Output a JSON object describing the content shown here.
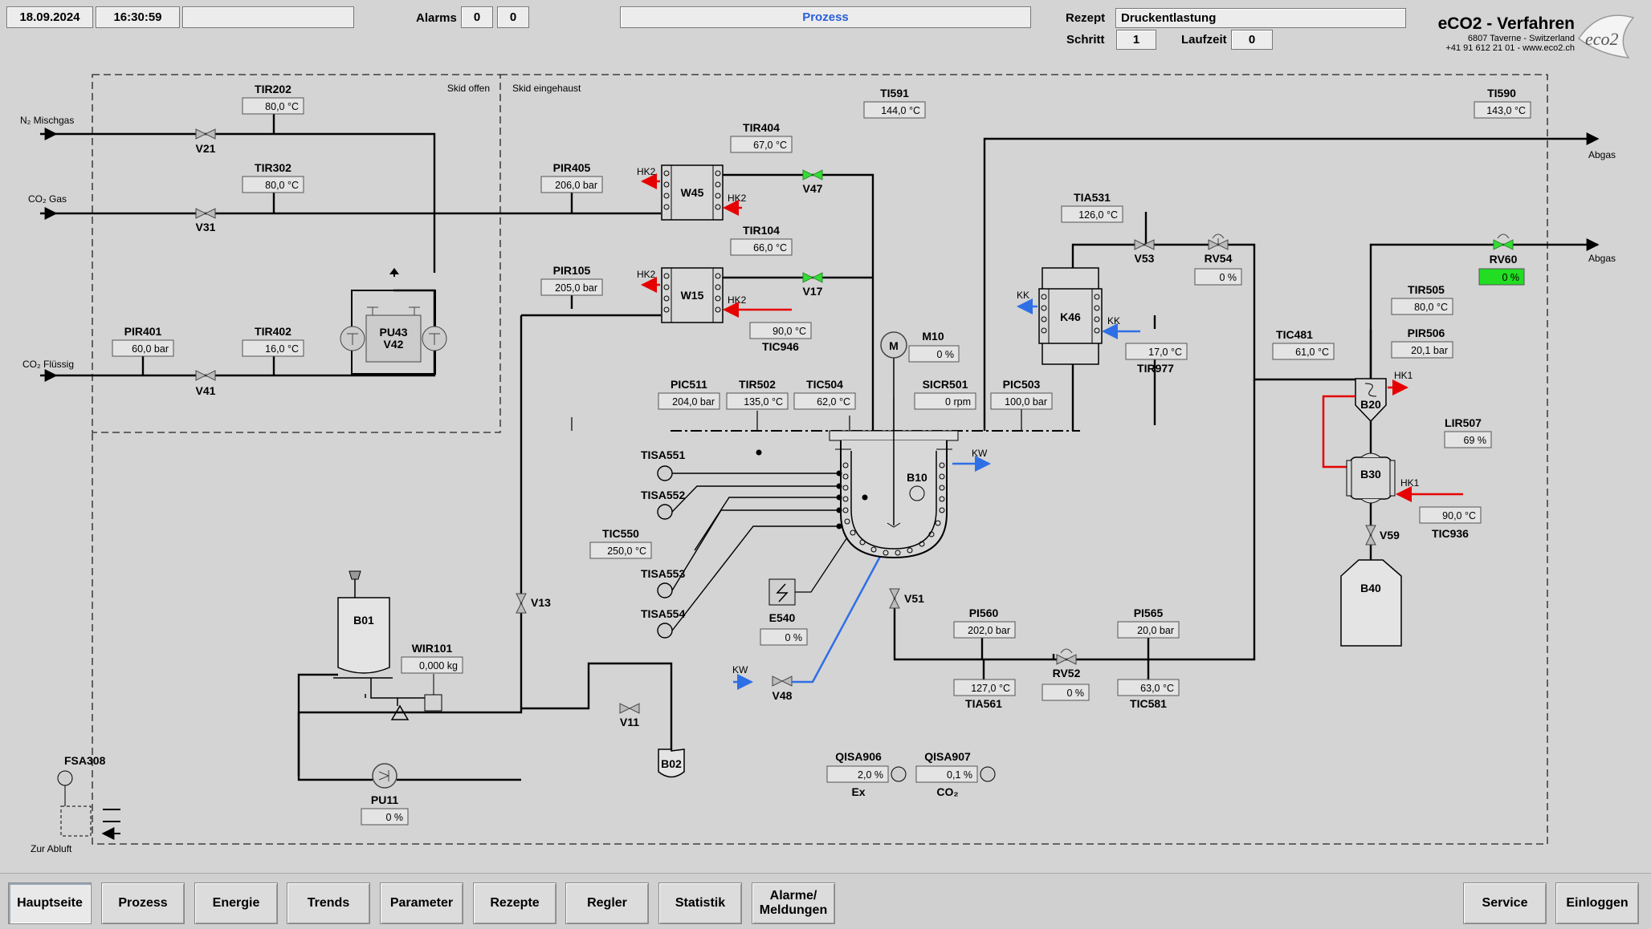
{
  "header": {
    "date": "18.09.2024",
    "time": "16:30:59",
    "status_text": "",
    "alarms_label": "Alarms",
    "alarms_count_1": "0",
    "alarms_count_2": "0",
    "view_title": "Prozess",
    "rezept_label": "Rezept",
    "rezept_value": "Druckentlastung",
    "schritt_label": "Schritt",
    "schritt_value": "1",
    "laufzeit_label": "Laufzeit",
    "laufzeit_value": "0",
    "brand_title": "eCO2 - Verfahren",
    "brand_line1": "6807 Taverne - Switzerland",
    "brand_line2": "+41 91 612 21 01 - www.eco2.ch",
    "logo_text": "eco2"
  },
  "diagram": {
    "skid_open": "Skid offen",
    "skid_enclosed": "Skid eingehaust",
    "inlet_n2": "N₂ Mischgas",
    "inlet_co2_gas": "CO₂ Gas",
    "inlet_co2_liquid": "CO₂ Flüssig",
    "outlet_abgas_1": "Abgas",
    "outlet_abgas_2": "Abgas",
    "zur_abluft": "Zur Abluft",
    "hk2_a": "HK2",
    "hk2_b": "HK2",
    "hk2_c": "HK2",
    "hk2_d": "HK2",
    "kk_a": "KK",
    "kk_b": "KK",
    "kw_a": "KW",
    "kw_b": "KW",
    "hk1_a": "HK1",
    "hk1_b": "HK1",
    "ex_label": "Ex",
    "co2_label": "CO₂",
    "equipment": {
      "W45": "W45",
      "W15": "W15",
      "K46": "K46",
      "B10": "B10",
      "B20": "B20",
      "B30": "B30",
      "B40": "B40",
      "B01": "B01",
      "B02": "B02",
      "PU43": "PU43",
      "V42": "V42",
      "M": "M",
      "PU11": "PU11",
      "E540": "E540"
    },
    "valves": {
      "V21": "V21",
      "V31": "V31",
      "V41": "V41",
      "V47": "V47",
      "V17": "V17",
      "V53": "V53",
      "RV54": "RV54",
      "RV60": "RV60",
      "V59": "V59",
      "V51": "V51",
      "V48": "V48",
      "RV52": "RV52",
      "V11": "V11",
      "V13": "V13"
    },
    "tags": {
      "TIR202": {
        "name": "TIR202",
        "value": "80,0 °C"
      },
      "TIR302": {
        "name": "TIR302",
        "value": "80,0 °C"
      },
      "PIR401": {
        "name": "PIR401",
        "value": "60,0 bar"
      },
      "TIR402": {
        "name": "TIR402",
        "value": "16,0 °C"
      },
      "PIR405": {
        "name": "PIR405",
        "value": "206,0 bar"
      },
      "TIR404": {
        "name": "TIR404",
        "value": "67,0 °C"
      },
      "PIR105": {
        "name": "PIR105",
        "value": "205,0 bar"
      },
      "TIR104": {
        "name": "TIR104",
        "value": "66,0 °C"
      },
      "TIC946": {
        "name": "TIC946",
        "value": "90,0 °C"
      },
      "TI591": {
        "name": "TI591",
        "value": "144,0 °C"
      },
      "TI590": {
        "name": "TI590",
        "value": "143,0 °C"
      },
      "TIA531": {
        "name": "TIA531",
        "value": "126,0 °C"
      },
      "RV54": {
        "name": "RV54",
        "value": "0 %"
      },
      "RV60": {
        "name": "RV60",
        "value": "0 %"
      },
      "TIR977": {
        "name": "TIR977",
        "value": "17,0 °C"
      },
      "M10": {
        "name": "M10",
        "value": "0 %"
      },
      "PIC511": {
        "name": "PIC511",
        "value": "204,0 bar"
      },
      "TIR502": {
        "name": "TIR502",
        "value": "135,0 °C"
      },
      "TIC504": {
        "name": "TIC504",
        "value": "62,0 °C"
      },
      "SICR501": {
        "name": "SICR501",
        "value": "0 rpm"
      },
      "PIC503": {
        "name": "PIC503",
        "value": "100,0 bar"
      },
      "TIC481": {
        "name": "TIC481",
        "value": "61,0 °C"
      },
      "TIR505": {
        "name": "TIR505",
        "value": "80,0 °C"
      },
      "PIR506": {
        "name": "PIR506",
        "value": "20,1 bar"
      },
      "LIR507": {
        "name": "LIR507",
        "value": "69 %"
      },
      "TIC936": {
        "name": "TIC936",
        "value": "90,0 °C"
      },
      "TIC550": {
        "name": "TIC550",
        "value": "250,0 °C"
      },
      "E540": {
        "name": "E540",
        "value": "0 %"
      },
      "PI560": {
        "name": "PI560",
        "value": "202,0 bar"
      },
      "TIA561": {
        "name": "TIA561",
        "value": "127,0 °C"
      },
      "RV52": {
        "name": "RV52",
        "value": "0 %"
      },
      "PI565": {
        "name": "PI565",
        "value": "20,0 bar"
      },
      "TIC581": {
        "name": "TIC581",
        "value": "63,0 °C"
      },
      "WIR101": {
        "name": "WIR101",
        "value": "0,000 kg"
      },
      "PU11": {
        "name": "PU11",
        "value": "0 %"
      },
      "QISA906": {
        "name": "QISA906",
        "value": "2,0 %"
      },
      "QISA907": {
        "name": "QISA907",
        "value": "0,1 %"
      }
    },
    "tisa": {
      "TISA551": "TISA551",
      "TISA552": "TISA552",
      "TISA553": "TISA553",
      "TISA554": "TISA554",
      "FSA308": "FSA308"
    }
  },
  "nav": {
    "hauptseite": "Hauptseite",
    "prozess": "Prozess",
    "energie": "Energie",
    "trends": "Trends",
    "parameter": "Parameter",
    "rezepte": "Rezepte",
    "regler": "Regler",
    "statistik": "Statistik",
    "alarme_1": "Alarme/",
    "alarme_2": "Meldungen",
    "service": "Service",
    "einloggen": "Einloggen"
  },
  "colors": {
    "background": "#d4d4d4",
    "hot": "#e60000",
    "cold": "#2f6fe6",
    "valve_open": "#22cc22",
    "active_value": "#22dd22"
  }
}
